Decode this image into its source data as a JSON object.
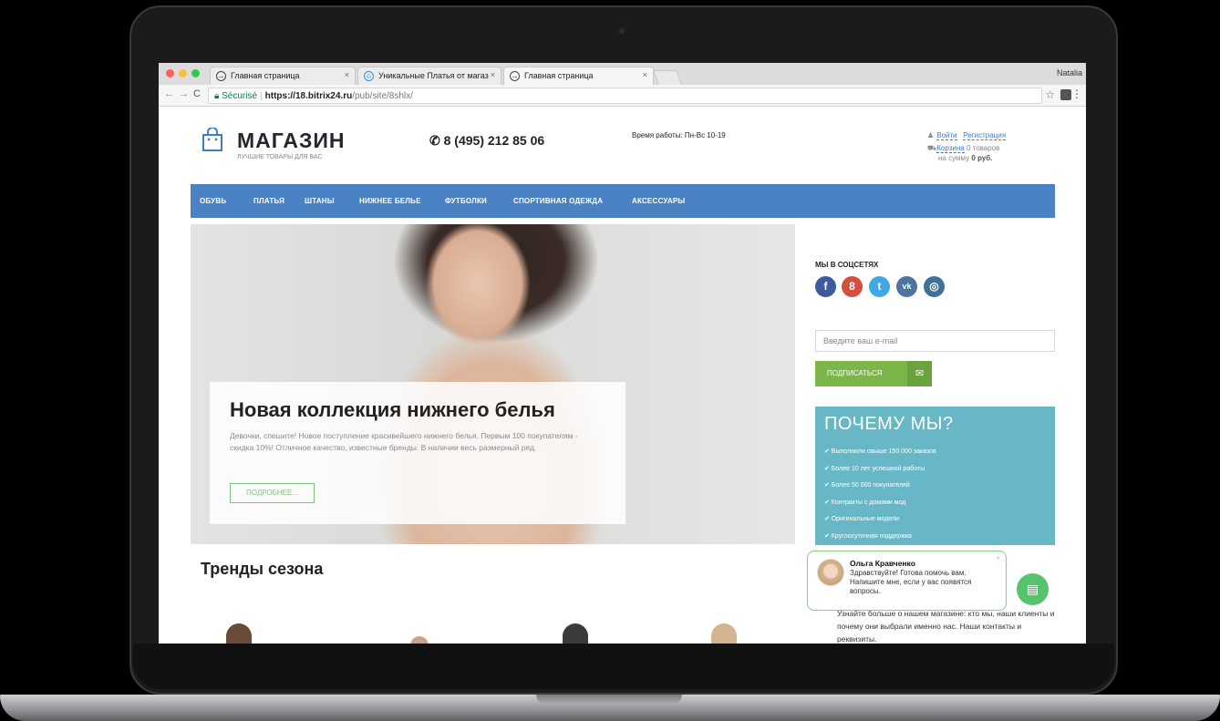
{
  "browser": {
    "tabs": [
      {
        "title": "Главная страница"
      },
      {
        "title": "Уникальные Платья от магаз"
      },
      {
        "title": "Главная страница"
      }
    ],
    "profile": "Natalia",
    "url": {
      "secure_label": "Sécurisé",
      "host": "https://18.bitrix24.ru",
      "path": "/pub/site/8shlx/"
    }
  },
  "header": {
    "logo_title": "МАГАЗИН",
    "logo_subtitle": "ЛУЧШИЕ ТОВАРЫ ДЛЯ ВАС",
    "phone": "8 (495) 212 85 06",
    "hours": "Время работы: Пн-Вс 10-19",
    "login": "Войти",
    "register": "Регистрация",
    "cart": "Корзина",
    "cart_count": "0 товаров",
    "cart_sum_prefix": "на сумму",
    "cart_sum": "0 руб."
  },
  "nav": {
    "items": [
      "ОБУВЬ",
      "ПЛАТЬЯ",
      "ШТАНЫ",
      "НИЖНЕЕ БЕЛЬЕ",
      "ФУТБОЛКИ",
      "СПОРТИВНАЯ ОДЕЖДА",
      "АКСЕССУАРЫ"
    ]
  },
  "hero": {
    "title": "Новая коллекция нижнего белья",
    "text": "Девочки, спешите! Новое поступление красивейшего нижнего белья. Первым 100 покупателям - скидка 10%! Отличное качество, известные бренды. В наличии весь размерный ряд.",
    "button": "ПОДРОБНЕЕ..."
  },
  "sidebar": {
    "social_title": "МЫ В СОЦСЕТЯХ",
    "social": [
      {
        "name": "facebook-icon",
        "glyph": "f",
        "color": "#3b5b9a"
      },
      {
        "name": "google-plus-icon",
        "glyph": "8",
        "color": "#d64f3d"
      },
      {
        "name": "twitter-icon",
        "glyph": "t",
        "color": "#3fa9e5"
      },
      {
        "name": "vk-icon",
        "glyph": "vk",
        "color": "#4c75a3"
      },
      {
        "name": "instagram-icon",
        "glyph": "◎",
        "color": "#3f729b"
      }
    ],
    "email_placeholder": "Введите ваш e-mail",
    "subscribe": "ПОДПИСАТЬСЯ",
    "why_title": "ПОЧЕМУ МЫ?",
    "why_items": [
      "✔ Выполнили свыше 150 000 заказов",
      "✔ Более 10 лет успешной работы",
      "✔ Более 50 000 покупателей",
      "✔ Контракты с домами мод",
      "✔ Оригинальные модели",
      "✔ Круглосуточная поддержка"
    ]
  },
  "trends_title": "Тренды сезона",
  "chat": {
    "name": "Ольга Кравченко",
    "message": "Здравствуйте! Готова помочь вам. Напишите мне, если у вас появятся вопросы.",
    "close": "×"
  },
  "about_text": "Узнайте больше о нашем магазине: кто мы, наши клиенты и почему они выбрали именно нас. Наши контакты и реквизиты."
}
